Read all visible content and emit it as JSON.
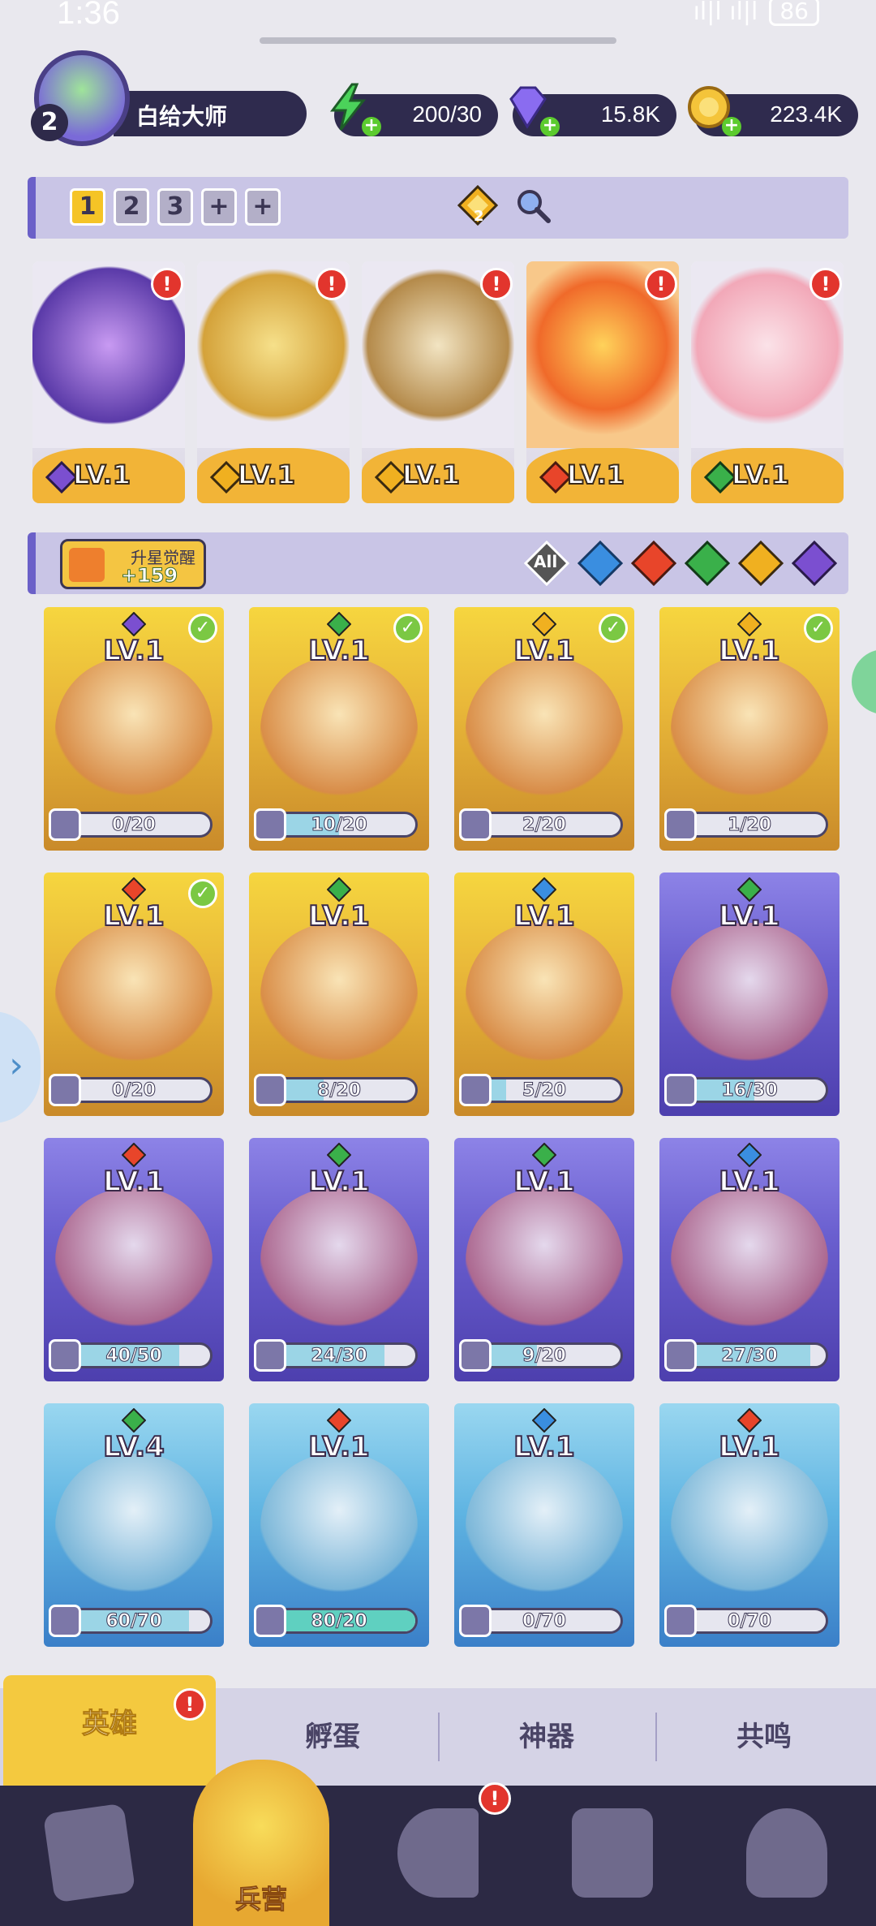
{
  "status_bar": {
    "time": "1:36",
    "signal": "ıl|l ıl|l",
    "battery": "86"
  },
  "player": {
    "level": "2",
    "name": "白给大师"
  },
  "currencies": {
    "energy": "200/30",
    "gems": "15.8K",
    "gold": "223.4K"
  },
  "team_tabs": [
    "1",
    "2",
    "3",
    "+",
    "+"
  ],
  "team_badge": "2",
  "team": [
    {
      "level": "LV.1",
      "element": "dark",
      "alert": "!"
    },
    {
      "level": "LV.1",
      "element": "light",
      "alert": "!"
    },
    {
      "level": "LV.1",
      "element": "light",
      "alert": "!"
    },
    {
      "level": "LV.1",
      "element": "fire",
      "alert": "!"
    },
    {
      "level": "LV.1",
      "element": "wind",
      "alert": "!"
    }
  ],
  "awaken": {
    "label": "升星觉醒",
    "value": "+159"
  },
  "filters": [
    "All",
    "water",
    "fire",
    "wind",
    "light",
    "dark"
  ],
  "heroes": [
    {
      "level": "LV.1",
      "progress": "0/20",
      "fill": 0.0,
      "checked": true,
      "theme": "gold",
      "element": "dark"
    },
    {
      "level": "LV.1",
      "progress": "10/20",
      "fill": 0.5,
      "checked": true,
      "theme": "gold",
      "element": "wind"
    },
    {
      "level": "LV.1",
      "progress": "2/20",
      "fill": 0.1,
      "checked": true,
      "theme": "gold",
      "element": "light"
    },
    {
      "level": "LV.1",
      "progress": "1/20",
      "fill": 0.05,
      "checked": true,
      "theme": "gold",
      "element": "light"
    },
    {
      "level": "LV.1",
      "progress": "0/20",
      "fill": 0.0,
      "checked": true,
      "theme": "gold",
      "element": "fire"
    },
    {
      "level": "LV.1",
      "progress": "8/20",
      "fill": 0.4,
      "checked": false,
      "theme": "gold",
      "element": "wind"
    },
    {
      "level": "LV.1",
      "progress": "5/20",
      "fill": 0.25,
      "checked": false,
      "theme": "gold",
      "element": "water"
    },
    {
      "level": "LV.1",
      "progress": "16/30",
      "fill": 0.53,
      "checked": false,
      "theme": "purple",
      "element": "wind"
    },
    {
      "level": "LV.1",
      "progress": "40/50",
      "fill": 0.8,
      "checked": false,
      "theme": "purple",
      "element": "fire"
    },
    {
      "level": "LV.1",
      "progress": "24/30",
      "fill": 0.8,
      "checked": false,
      "theme": "purple",
      "element": "wind"
    },
    {
      "level": "LV.1",
      "progress": "9/20",
      "fill": 0.45,
      "checked": false,
      "theme": "purple",
      "element": "wind"
    },
    {
      "level": "LV.1",
      "progress": "27/30",
      "fill": 0.9,
      "checked": false,
      "theme": "purple",
      "element": "water"
    },
    {
      "level": "LV.4",
      "progress": "60/70",
      "fill": 0.86,
      "checked": false,
      "theme": "blue",
      "element": "wind"
    },
    {
      "level": "LV.1",
      "progress": "80/20",
      "fill": 1.0,
      "checked": false,
      "theme": "blue",
      "element": "fire"
    },
    {
      "level": "LV.1",
      "progress": "0/70",
      "fill": 0.0,
      "checked": false,
      "theme": "blue",
      "element": "water"
    },
    {
      "level": "LV.1",
      "progress": "0/70",
      "fill": 0.0,
      "checked": false,
      "theme": "blue",
      "element": "fire"
    }
  ],
  "sub_tabs": [
    {
      "label": "英雄",
      "active": true,
      "alert": "!"
    },
    {
      "label": "孵蛋",
      "active": false
    },
    {
      "label": "神器",
      "active": false
    },
    {
      "label": "共鸣",
      "active": false
    }
  ],
  "nav": {
    "active_label": "兵营",
    "alert": "!"
  },
  "colors": {
    "dark": "#7b4fd0",
    "light": "#f0b020",
    "fire": "#e8452a",
    "wind": "#3ab04a",
    "water": "#3a8ee0"
  }
}
